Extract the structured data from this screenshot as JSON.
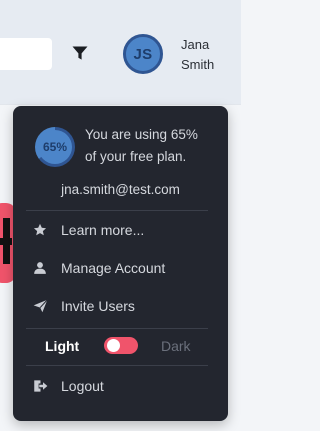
{
  "header": {
    "search": {
      "value": "",
      "placeholder": ""
    },
    "filter_icon": "filter-icon",
    "user": {
      "initials": "JS",
      "first_name": "Jana",
      "last_name": "Smith"
    }
  },
  "menu": {
    "usage": {
      "percent_label": "65%",
      "percent_value": 0.65,
      "line1": "You are using 65%",
      "line2": "of your free plan."
    },
    "email": "jna.smith@test.com",
    "items": [
      {
        "label": "Learn more...",
        "icon": "star-icon"
      },
      {
        "label": "Manage Account",
        "icon": "user-icon"
      },
      {
        "label": "Invite Users",
        "icon": "send-icon"
      }
    ],
    "theme": {
      "light_label": "Light",
      "dark_label": "Dark",
      "selected": "Light"
    },
    "logout": {
      "label": "Logout",
      "icon": "logout-icon"
    }
  },
  "colors": {
    "menu_bg": "#23262f",
    "accent": "#f0546b",
    "avatar_fill": "#4c85c9",
    "avatar_ring": "#2f5592",
    "topbar_bg": "#e6ebf2"
  }
}
